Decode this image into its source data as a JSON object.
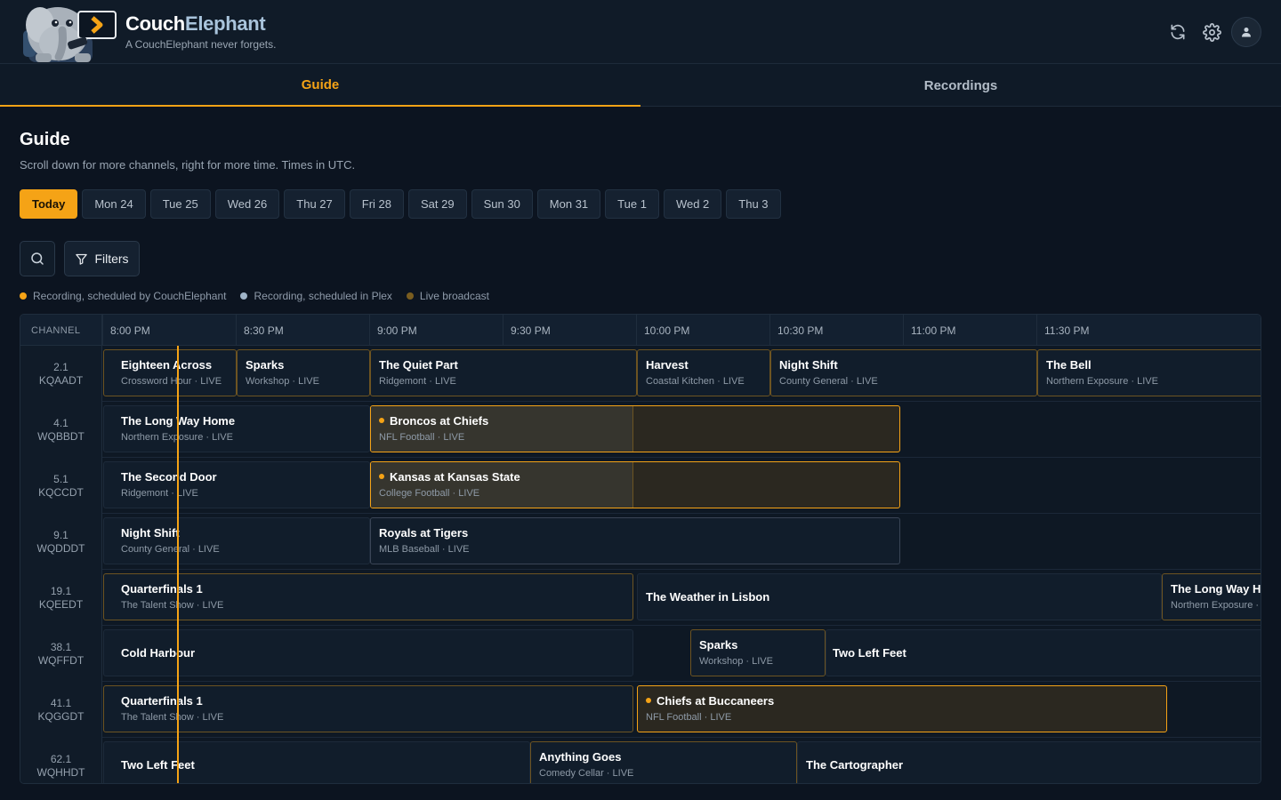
{
  "app": {
    "name_part1": "Couch",
    "name_part2": "Elephant",
    "tagline": "A CouchElephant never forgets.",
    "accent_color": "#f5a316"
  },
  "header": {
    "icons": [
      "refresh-icon",
      "settings-icon",
      "user-icon"
    ]
  },
  "tabs": [
    {
      "label": "Guide",
      "active": true
    },
    {
      "label": "Recordings",
      "active": false
    }
  ],
  "page": {
    "title": "Guide",
    "subtitle": "Scroll down for more channels, right for more time. Times in UTC."
  },
  "days": [
    "Today",
    "Mon 24",
    "Tue 25",
    "Wed 26",
    "Thu 27",
    "Fri 28",
    "Sat 29",
    "Sun 30",
    "Mon 31",
    "Tue 1",
    "Wed 2",
    "Thu 3"
  ],
  "toolbar": {
    "filters_label": "Filters"
  },
  "legend": [
    {
      "label": "Recording, scheduled by CouchElephant",
      "color": "#f5a316"
    },
    {
      "label": "Recording, scheduled in Plex",
      "color": "#9fb4c8"
    },
    {
      "label": "Live broadcast",
      "color": "#7a5d1f"
    }
  ],
  "guide": {
    "channel_header": "CHANNEL",
    "times": [
      "8:00 PM",
      "8:30 PM",
      "9:00 PM",
      "9:30 PM",
      "10:00 PM",
      "10:30 PM",
      "11:00 PM",
      "11:30 PM"
    ],
    "channels": [
      {
        "number": "2.1",
        "callsign": "KQAADT",
        "programs": [
          {
            "title": "Eighteen Across",
            "subtitle": "Crossword Hour · LIVE"
          },
          {
            "title": "Sparks",
            "subtitle": "Workshop · LIVE"
          },
          {
            "title": "The Quiet Part",
            "subtitle": "Ridgemont · LIVE"
          },
          {
            "title": "Harvest",
            "subtitle": "Coastal Kitchen · LIVE"
          },
          {
            "title": "Night Shift",
            "subtitle": "County General · LIVE"
          },
          {
            "title": "The Bell",
            "subtitle": "Northern Exposure · LIVE"
          }
        ]
      },
      {
        "number": "4.1",
        "callsign": "WQBBDT",
        "programs": [
          {
            "title": "The Long Way Home",
            "subtitle": "Northern Exposure · LIVE"
          },
          {
            "title": "Broncos at Chiefs",
            "subtitle": "NFL Football · LIVE"
          }
        ]
      },
      {
        "number": "5.1",
        "callsign": "KQCCDT",
        "programs": [
          {
            "title": "The Second Door",
            "subtitle": "Ridgemont · LIVE"
          },
          {
            "title": "Kansas at Kansas State",
            "subtitle": "College Football · LIVE"
          }
        ]
      },
      {
        "number": "9.1",
        "callsign": "WQDDDT",
        "programs": [
          {
            "title": "Night Shift",
            "subtitle": "County General · LIVE"
          },
          {
            "title": "Royals at Tigers",
            "subtitle": "MLB Baseball · LIVE"
          }
        ]
      },
      {
        "number": "19.1",
        "callsign": "KQEEDT",
        "programs": [
          {
            "title": "Quarterfinals 1",
            "subtitle": "The Talent Show · LIVE"
          },
          {
            "title": "The Weather in Lisbon",
            "subtitle": ""
          },
          {
            "title": "The Long Way H",
            "subtitle": "Northern Exposure ·"
          }
        ]
      },
      {
        "number": "38.1",
        "callsign": "WQFFDT",
        "programs": [
          {
            "title": "Cold Harbour",
            "subtitle": ""
          },
          {
            "title": "Sparks",
            "subtitle": "Workshop · LIVE"
          },
          {
            "title": "Two Left Feet",
            "subtitle": ""
          }
        ]
      },
      {
        "number": "41.1",
        "callsign": "KQGGDT",
        "programs": [
          {
            "title": "Quarterfinals 1",
            "subtitle": "The Talent Show · LIVE"
          },
          {
            "title": "Chiefs at Buccaneers",
            "subtitle": "NFL Football · LIVE"
          }
        ]
      },
      {
        "number": "62.1",
        "callsign": "WQHHDT",
        "programs": [
          {
            "title": "Two Left Feet",
            "subtitle": ""
          },
          {
            "title": "Anything Goes",
            "subtitle": "Comedy Cellar · LIVE"
          },
          {
            "title": "The Cartographer",
            "subtitle": ""
          }
        ]
      }
    ]
  }
}
